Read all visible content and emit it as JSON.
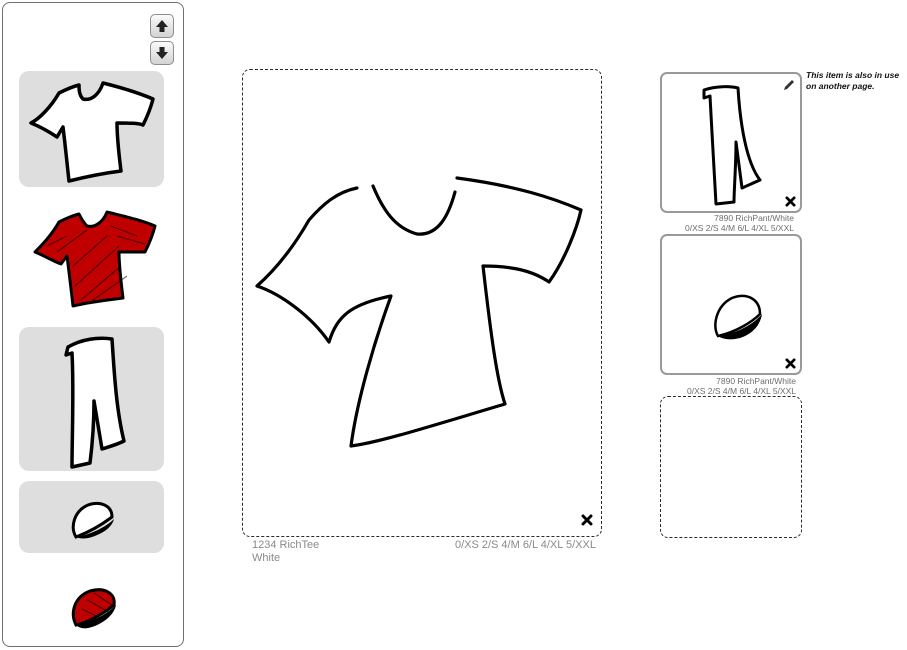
{
  "sidebar": {
    "scroll_up_icon": "arrow-up-icon",
    "scroll_down_icon": "arrow-down-icon",
    "items": [
      {
        "name": "white-tee",
        "selected": true
      },
      {
        "name": "red-tee",
        "selected": false
      },
      {
        "name": "white-pant",
        "selected": true
      },
      {
        "name": "white-hat",
        "selected": true
      },
      {
        "name": "red-hat",
        "selected": false
      }
    ]
  },
  "main_card": {
    "product_line1": "1234 RichTee",
    "product_line2": "White",
    "sizes": "0/XS 2/S 4/M 6/L 4/XL 5/XXL",
    "remove_icon": "close-icon"
  },
  "side_cards": [
    {
      "caption_line1": "7890 RichPant/White",
      "caption_line2": "0/XS 2/S 4/M 6/L 4/XL 5/XXL",
      "edit_icon": "pencil-icon",
      "remove_icon": "close-icon"
    },
    {
      "caption_line1": "7890 RichPant/White",
      "caption_line2": "0/XS 2/S 4/M 6/L 4/XL 5/XXL",
      "remove_icon": "close-icon"
    }
  ],
  "note": "This item is also in use on another page.",
  "colors": {
    "accent_red": "#c00000",
    "selected_bg": "#dedede",
    "border": "#9a9a9a"
  }
}
